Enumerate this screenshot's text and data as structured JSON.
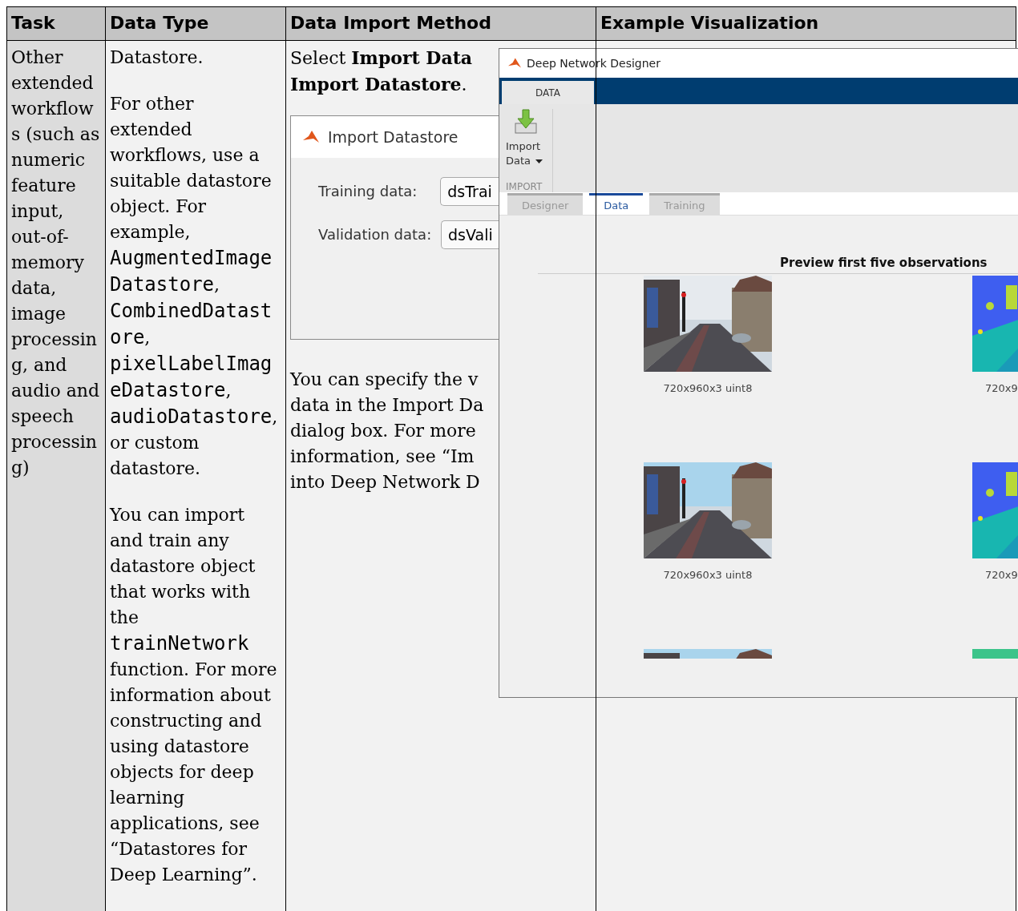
{
  "table": {
    "columns": [
      "Task",
      "Data Type",
      "Data Import Method",
      "Example Visualization"
    ],
    "rows": [
      {
        "task": "Other extended workflows (such as numeric feature input, out-of-memory data, image processing, and audio and speech processing)",
        "data_type": [
          [
            {
              "kind": "plain",
              "text": "Datastore."
            }
          ],
          [
            {
              "kind": "plain",
              "text": "For other extended workflows, use a suitable datastore object. For example, "
            },
            {
              "kind": "code",
              "text": "AugmentedImageDatastore"
            },
            {
              "kind": "plain",
              "text": ", "
            },
            {
              "kind": "code",
              "text": "CombinedDatastore"
            },
            {
              "kind": "plain",
              "text": ", "
            },
            {
              "kind": "code",
              "text": "pixelLabelImageDatastore"
            },
            {
              "kind": "plain",
              "text": ", "
            },
            {
              "kind": "code",
              "text": "audioDatastore"
            },
            {
              "kind": "plain",
              "text": ", or custom datastore."
            }
          ],
          [
            {
              "kind": "plain",
              "text": "You can import and train any datastore object that works with the "
            },
            {
              "kind": "code",
              "text": "trainNetwork"
            },
            {
              "kind": "plain",
              "text": " function. For more information about constructing and using datastore objects for deep learning applications, see “Datastores for Deep Learning”."
            }
          ]
        ],
        "import_method": {
          "intro_lines": [
            "Select **Import Data**",
            "**Import Datastore**."
          ],
          "dialog": {
            "title": "Import Datastore",
            "fields": [
              {
                "label": "Training data:",
                "value": "dsTrai"
              },
              {
                "label": "Validation data:",
                "value": "dsVali"
              }
            ]
          },
          "note_lines": [
            "You can specify the v",
            "data in the Import Da",
            "dialog box. For more",
            "information, see “Im",
            "into Deep Network D"
          ]
        },
        "example": {
          "window": {
            "title": "Deep Network Designer",
            "ribbon_tabs": [
              {
                "label": "DATA",
                "selected": true
              }
            ],
            "import_button": {
              "lines": [
                "Import",
                "Data"
              ]
            },
            "section_label": "IMPORT",
            "tabs": [
              {
                "label": "Designer",
                "selected": false
              },
              {
                "label": "Data",
                "selected": true
              },
              {
                "label": "Training",
                "selected": false
              }
            ],
            "preview_title": "Preview first five observations",
            "observations": [
              {
                "kind": "picture",
                "caption": "720x960x3 uint8"
              },
              {
                "kind": "picture",
                "caption": "720x9"
              },
              {
                "kind": "picture",
                "caption": "720x960x3 uint8"
              },
              {
                "kind": "picture",
                "caption": "720x9"
              },
              {
                "kind": "picture"
              },
              {
                "kind": "picture"
              }
            ]
          }
        }
      }
    ]
  }
}
